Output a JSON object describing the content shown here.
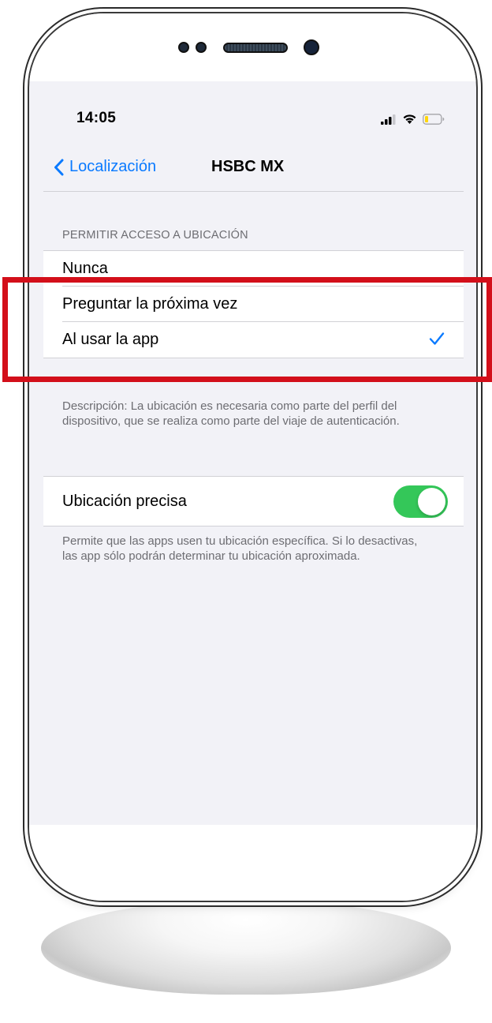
{
  "status_bar": {
    "time": "14:05"
  },
  "navbar": {
    "back_label": "Localización",
    "title": "HSBC MX"
  },
  "location_access": {
    "header": "PERMITIR ACCESO A UBICACIÓN",
    "options": [
      {
        "label": "Nunca",
        "selected": false
      },
      {
        "label": "Preguntar la próxima vez",
        "selected": false
      },
      {
        "label": "Al usar la app",
        "selected": true
      }
    ],
    "description": "Descripción: La ubicación es necesaria como parte del perfil del dispositivo, que se realiza como parte del viaje de autenticación."
  },
  "precise_location": {
    "label": "Ubicación precisa",
    "enabled": true,
    "description": "Permite que las apps usen tu ubicación específica. Si lo desactivas, las app sólo podrán determinar tu ubicación aproximada."
  },
  "colors": {
    "accent": "#0a7aff",
    "toggle_on": "#34c759",
    "highlight": "#d30f1a"
  },
  "icons": [
    "chevron-left-icon",
    "checkmark-icon",
    "signal-icon",
    "wifi-icon",
    "battery-icon"
  ]
}
